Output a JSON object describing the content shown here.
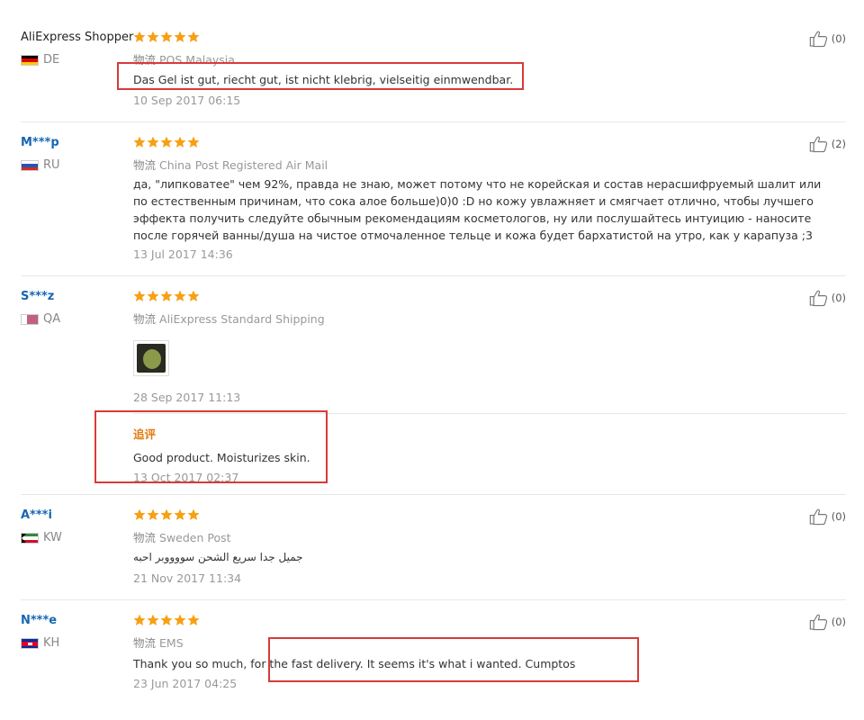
{
  "reviews": [
    {
      "user": "AliExpress Shopper",
      "country": "DE",
      "logistics_prefix": "物流",
      "logistics": "POS Malaysia",
      "text": "Das Gel ist gut, riecht gut, ist nicht klebrig, vielseitig einmwendbar.",
      "date": "10 Sep 2017 06:15",
      "likes": "(0)",
      "rating": 5
    },
    {
      "user": "M***p",
      "country": "RU",
      "logistics_prefix": "物流",
      "logistics": "China Post Registered Air Mail",
      "text": "да, \"липковатее\" чем 92%, правда не знаю, может потому что не корейская и состав нерасшифруемый шалит или по естественным причинам, что сока алое больше)0)0 :D но кожу увлажняет и смягчает отлично, чтобы лучшего эффекта получить следуйте обычным рекомендациям косметологов, ну или послушайтесь интуицию - наносите после горячей ванны/душа на чистое отмочаленное тельце и кожа будет бархатистой на утро, как у карапуза ;3",
      "date": "13 Jul 2017 14:36",
      "likes": "(2)",
      "rating": 5
    },
    {
      "user": "S***z",
      "country": "QA",
      "logistics_prefix": "物流",
      "logistics": "AliExpress Standard Shipping",
      "date": "28 Sep 2017 11:13",
      "likes": "(0)",
      "rating": 5,
      "additional": {
        "label": "追评",
        "text": "Good product. Moisturizes skin.",
        "date": "13 Oct 2017 02:37"
      }
    },
    {
      "user": "A***i",
      "country": "KW",
      "logistics_prefix": "物流",
      "logistics": "Sweden Post",
      "text": "جميل جدا سريع الشحن سووووبر احبه",
      "date": "21 Nov 2017 11:34",
      "likes": "(0)",
      "rating": 5
    },
    {
      "user": "N***e",
      "country": "KH",
      "logistics_prefix": "物流",
      "logistics": "EMS",
      "text": "Thank you so much, for the fast delivery. It seems it's what i wanted. Cumptos",
      "date": "23 Jun 2017 04:25",
      "likes": "(0)",
      "rating": 5
    }
  ],
  "colors": {
    "star": "#f7a014",
    "username_link": "#1766b1",
    "highlight_box": "#d83a3a",
    "additional_label": "#e07a11"
  },
  "icons": {
    "like": "thumbs-up-icon",
    "rating": "star-icon"
  }
}
